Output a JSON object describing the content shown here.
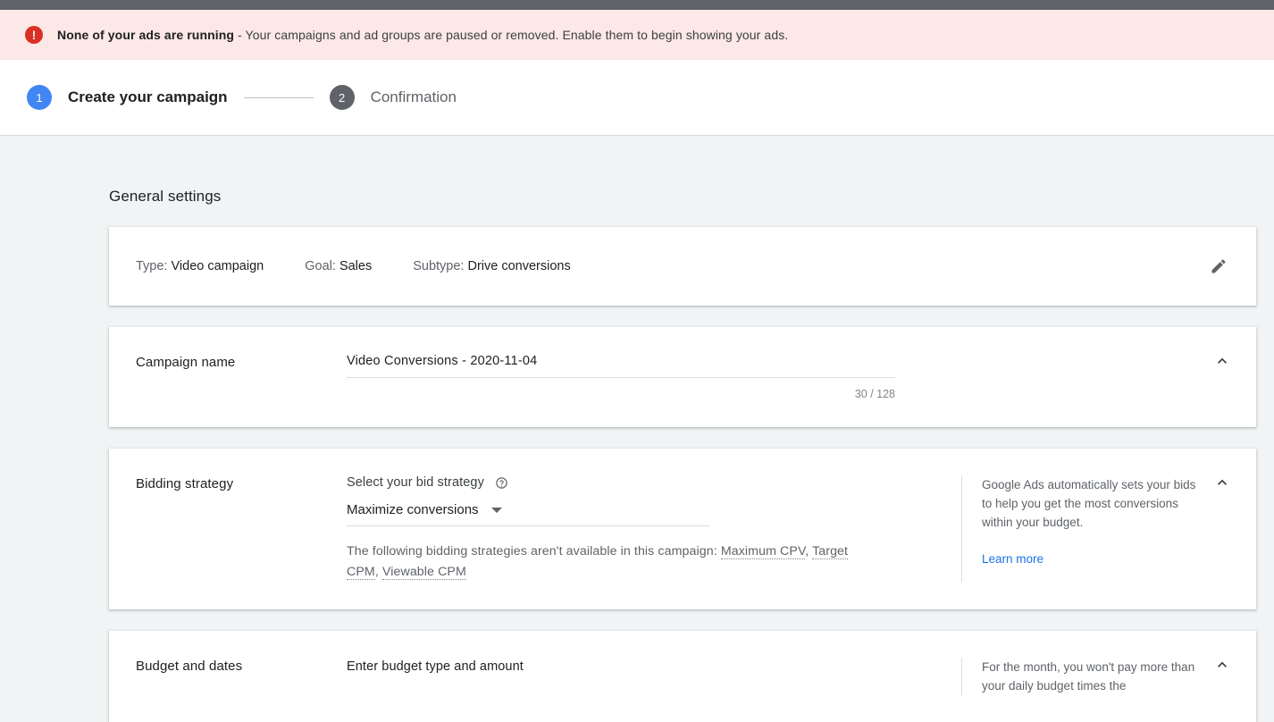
{
  "alert": {
    "icon": "error-exclamation-icon",
    "title": "None of your ads are running",
    "separator": " - ",
    "message": "Your campaigns and ad groups are paused or removed. Enable them to begin showing your ads.",
    "bg_color": "#fce8e6",
    "icon_color": "#d93025"
  },
  "stepper": {
    "steps": [
      {
        "number": "1",
        "label": "Create your campaign",
        "state": "active",
        "color": "#4285f4"
      },
      {
        "number": "2",
        "label": "Confirmation",
        "state": "inactive",
        "color": "#5f6368"
      }
    ]
  },
  "page": {
    "section_title": "General settings",
    "background": "#f1f3f4"
  },
  "type_card": {
    "type_label": "Type:",
    "type_value": "Video campaign",
    "goal_label": "Goal:",
    "goal_value": "Sales",
    "subtype_label": "Subtype:",
    "subtype_value": "Drive conversions",
    "edit_icon": "pencil-edit-icon"
  },
  "campaign_name": {
    "label": "Campaign name",
    "value": "Video Conversions - 2020-11-04",
    "placeholder": "Campaign name",
    "counter": "30 / 128",
    "chevron": "chevron-up-icon"
  },
  "bidding": {
    "label": "Bidding strategy",
    "field_title": "Select your bid strategy",
    "help_icon": "help-question-icon",
    "selected": "Maximize conversions",
    "options": [
      "Maximize conversions"
    ],
    "note_prefix": "The following bidding strategies aren't available in this campaign: ",
    "unavailable": [
      "Maximum CPV",
      "Target CPM",
      "Viewable CPM"
    ],
    "side_text": "Google Ads automatically sets your bids to help you get the most conversions within your budget.",
    "learn_more": "Learn more",
    "link_color": "#1a73e8",
    "chevron": "chevron-up-icon"
  },
  "budget": {
    "label": "Budget and dates",
    "prompt": "Enter budget type and amount",
    "side_text": "For the month, you won't pay more than your daily budget times the",
    "chevron": "chevron-up-icon"
  }
}
